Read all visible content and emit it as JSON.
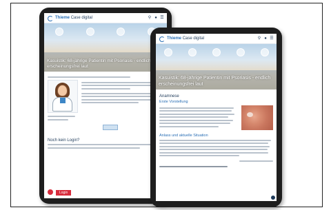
{
  "brand": {
    "logo_name": "Thieme",
    "logo_sub": "Case digital"
  },
  "topbar_icons": [
    "search-icon",
    "user-icon",
    "menu-icon"
  ],
  "back_tablet": {
    "title": "Kasuistik: 68-jährige Patientin mit Psoriasis - endlich erscheinungsfrei laut",
    "section_heading": "Noch kein Login?",
    "login_label": "Login"
  },
  "front_tablet": {
    "title": "Kasuistik: 68-jährige Patientin mit Psoriasis - endlich erscheinungsfrei laut",
    "section_heading": "Anamnese",
    "subheading_1": "Erste Vorstellung",
    "subheading_2": "Anlass und aktuelle Situation"
  },
  "colors": {
    "brand_blue": "#2a6fb5",
    "login_red": "#d72c3c",
    "device": "#1e1e1e"
  }
}
